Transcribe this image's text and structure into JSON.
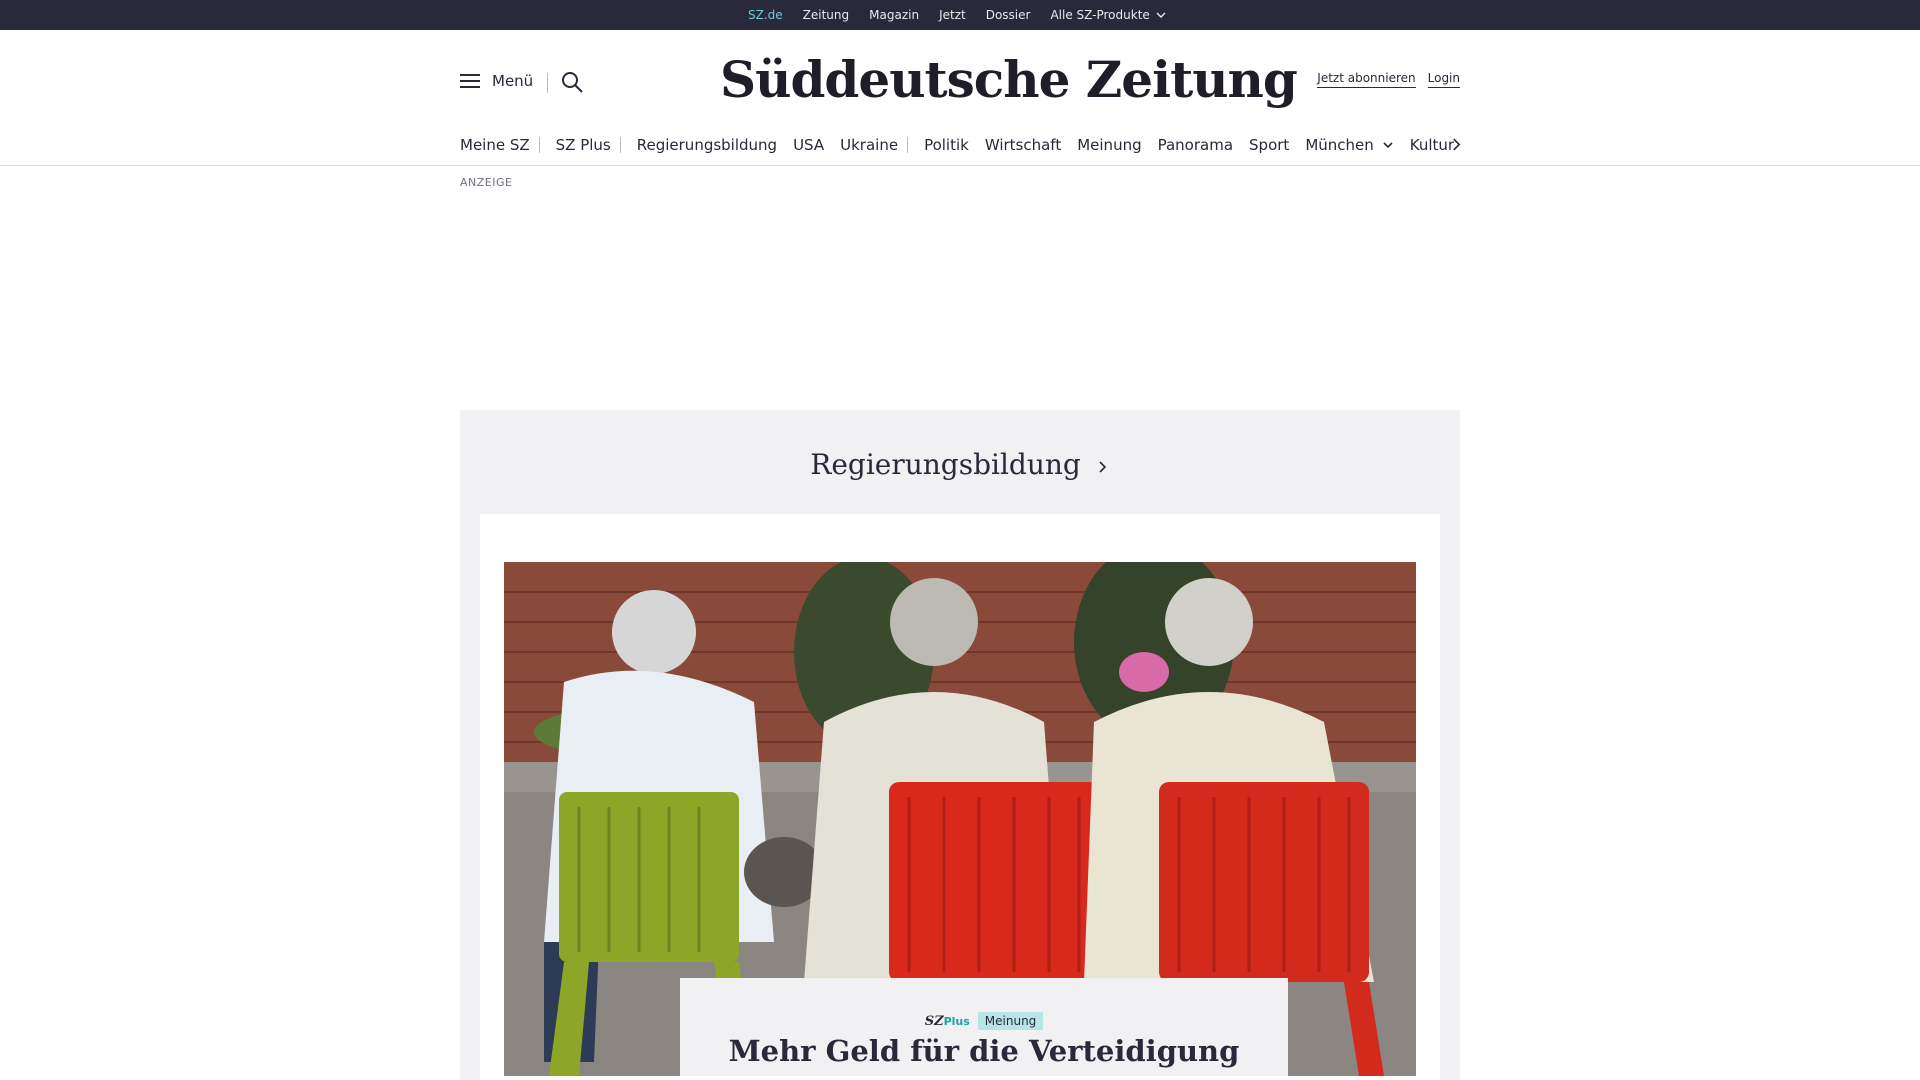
{
  "topbar": {
    "items": [
      {
        "label": "SZ.de",
        "active": true
      },
      {
        "label": "Zeitung"
      },
      {
        "label": "Magazin"
      },
      {
        "label": "Jetzt"
      },
      {
        "label": "Dossier"
      },
      {
        "label": "Alle SZ-Produkte",
        "dropdown": true
      }
    ]
  },
  "header": {
    "menu_label": "Menü",
    "logo_text": "Süddeutsche Zeitung",
    "subscribe_label": "Jetzt abonnieren",
    "login_label": "Login"
  },
  "ressorts": [
    "Meine SZ",
    "SZ Plus",
    "Regierungsbildung",
    "USA",
    "Ukraine",
    "Politik",
    "Wirtschaft",
    "Meinung",
    "Panorama",
    "Sport",
    "München",
    "Kultur"
  ],
  "ad": {
    "label": "ANZEIGE"
  },
  "teaser_block": {
    "title": "Regierungsbildung",
    "article": {
      "brand": "SZ",
      "brand_suffix": "Plus",
      "category": "Meinung",
      "headline": "Mehr Geld für die Verteidigung",
      "image_icon": "photo-three-seniors-on-chairs"
    }
  },
  "colors": {
    "topbar_bg": "#29293a",
    "active_link": "#71c7e0",
    "block_bg": "#f1f1f3",
    "badge_bg": "#b7e4e4",
    "plus_accent": "#1aa3a3"
  }
}
